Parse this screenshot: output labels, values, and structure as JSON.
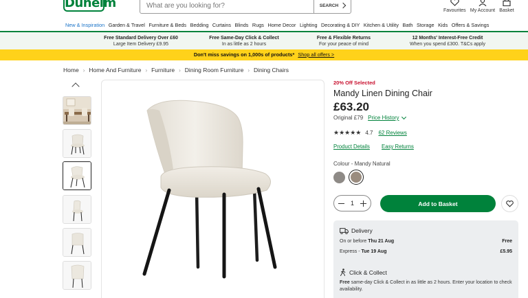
{
  "header": {
    "logo": "Dunelm",
    "search_placeholder": "What are you looking for?",
    "search_button": "SEARCH",
    "actions": [
      {
        "label": "Favourites",
        "icon": "heart-icon"
      },
      {
        "label": "My Account",
        "icon": "user-icon"
      },
      {
        "label": "Basket",
        "icon": "basket-icon"
      }
    ]
  },
  "nav": [
    "New & Inspiration",
    "Garden & Travel",
    "Furniture & Beds",
    "Bedding",
    "Curtains",
    "Blinds",
    "Rugs",
    "Home Decor",
    "Lighting",
    "Decorating & DIY",
    "Kitchen & Utility",
    "Bath",
    "Storage",
    "Kids",
    "Offers & Savings"
  ],
  "usps": [
    {
      "title": "Free Standard Delivery Over £60",
      "sub": "Large Item Delivery £9.95"
    },
    {
      "title": "Free Same-Day Click & Collect",
      "sub": "In as little as 2 hours"
    },
    {
      "title": "Free & Flexible Returns",
      "sub": "For your peace of mind"
    },
    {
      "title": "12 Months' Interest-Free Credit",
      "sub": "When you spend £300. T&Cs apply"
    }
  ],
  "promo": {
    "text": "Don't miss savings on 1,000s of products*",
    "link": "Shop all offers >"
  },
  "breadcrumb": [
    "Home",
    "Home And Furniture",
    "Furniture",
    "Dining Room Furniture",
    "Dining Chairs"
  ],
  "product": {
    "offer": "20% Off Selected",
    "title": "Mandy Linen Dining Chair",
    "price": "£63.20",
    "original": "Original £79",
    "price_history": "Price History",
    "stars": "★★★★★",
    "rating": "4.7",
    "reviews": "62 Reviews",
    "details_link": "Product Details",
    "returns_link": "Easy Returns",
    "colour_label": "Colour - Mandy Natural",
    "quantity": "1",
    "add_button": "Add to Basket"
  },
  "delivery": {
    "title": "Delivery",
    "rows": [
      {
        "label": "On or before",
        "date": "Thu 21 Aug",
        "price": "Free"
      },
      {
        "label": "Express -",
        "date": "Tue 19 Aug",
        "price": "£5.95"
      }
    ],
    "collect_title": "Click & Collect",
    "collect_free": "Free",
    "collect_text": " same-day Click & Collect in as little as 2 hours. Enter your location to check availability."
  },
  "colors": {
    "brand": "#00823b",
    "promo": "#ffd21a",
    "offer": "#c8102e",
    "link": "#1a73c8"
  }
}
